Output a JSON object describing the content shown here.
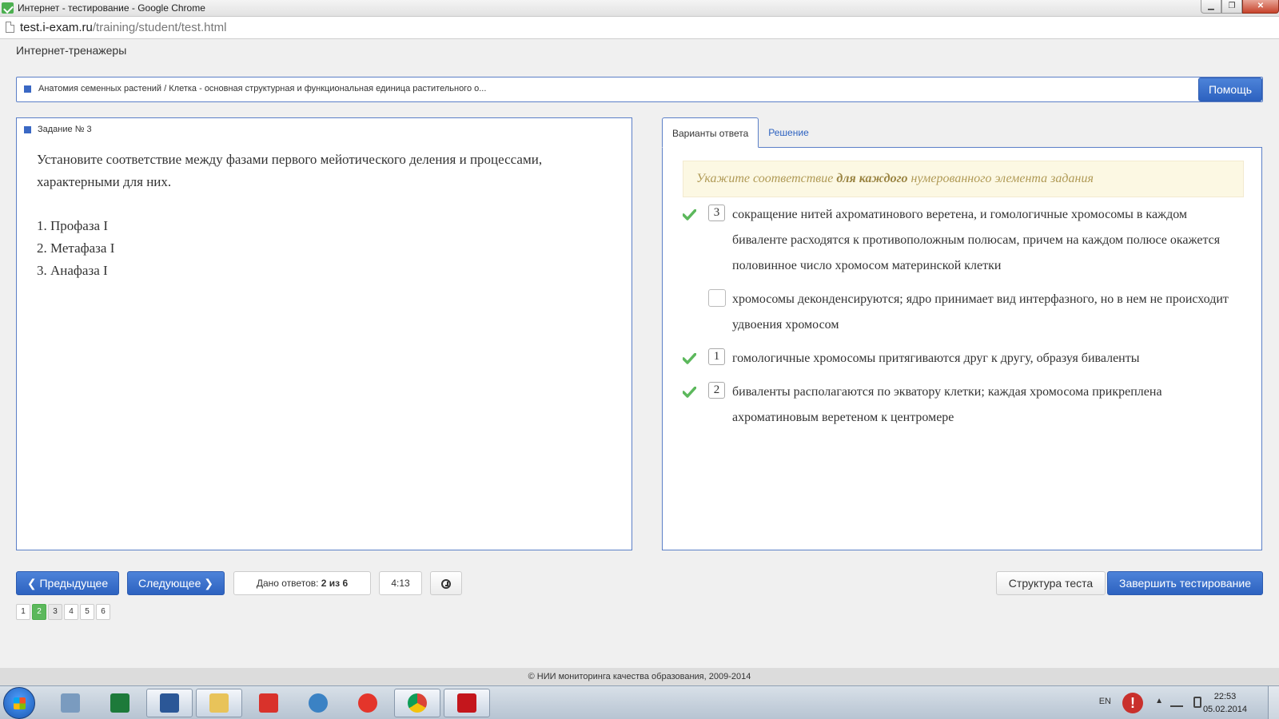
{
  "window": {
    "title": "Интернет - тестирование - Google Chrome",
    "controls": {
      "minimize": "▁",
      "maximize": "❐",
      "close": "✕"
    }
  },
  "address": {
    "host": "test.i-exam.ru",
    "path": "/training/student/test.html"
  },
  "site": {
    "title": "Интернет-тренажеры"
  },
  "topic": {
    "text": "Анатомия семенных растений / Клетка - основная структурная и функциональная единица растительного о...",
    "help_label": "Помощь"
  },
  "question": {
    "header": "Задание № 3",
    "text": "Установите соответствие между фазами первого мейотического деления и процессами, характерными для них.",
    "items": [
      "1. Профаза I",
      "2. Метафаза I",
      "3. Анафаза I"
    ]
  },
  "answers": {
    "tabs": [
      {
        "label": "Варианты ответа",
        "active": true
      },
      {
        "label": "Решение",
        "active": false
      }
    ],
    "hint": {
      "part1": "Укажите соответствие ",
      "bold": "для каждого",
      "part2": " нумерованного элемента задания"
    },
    "options": [
      {
        "number": "3",
        "checked": true,
        "text": "сокращение нитей ахроматинового веретена, и гомологичные хромосомы в каждом биваленте расходятся к противоположным полюсам, причем на каждом полюсе окажется половинное число хромосом материнской клетки"
      },
      {
        "number": "",
        "checked": false,
        "text": "хромосомы деконденсируются; ядро принимает вид интерфазного, но в нем не происходит удвоения хромосом"
      },
      {
        "number": "1",
        "checked": true,
        "text": "гомологичные хромосомы притягиваются друг к другу, образуя биваленты"
      },
      {
        "number": "2",
        "checked": true,
        "text": "биваленты располагаются по экватору клетки; каждая хромосома прикреплена ахроматиновым веретеном к центромере"
      }
    ]
  },
  "nav": {
    "prev_label": "Предыдущее",
    "next_label": "Следующее",
    "answered_label": "Дано ответов:",
    "answered_value": "2 из 6",
    "timer": "4:13",
    "structure_label": "Структура теста",
    "finish_label": "Завершить тестирование",
    "pages": [
      "1",
      "2",
      "3",
      "4",
      "5",
      "6"
    ],
    "current_page": "2"
  },
  "footer": {
    "text": "© НИИ мониторинга качества образования, 2009-2014"
  },
  "taskbar": {
    "apps": [
      "calculator-icon",
      "excel-icon",
      "word-icon",
      "file-explorer-icon",
      "yandex-icon",
      "volume-app-icon",
      "yandex-browser-icon",
      "chrome-icon",
      "acrobat-icon"
    ],
    "lang": "EN",
    "alert": "!",
    "arrow": "▲",
    "time": "22:53",
    "date": "05.02.2014"
  },
  "colors": {
    "accent": "#2d62c0",
    "panel_border": "#5b7fc7",
    "check": "#5cb85c",
    "hint_bg": "#fcf8e3"
  }
}
